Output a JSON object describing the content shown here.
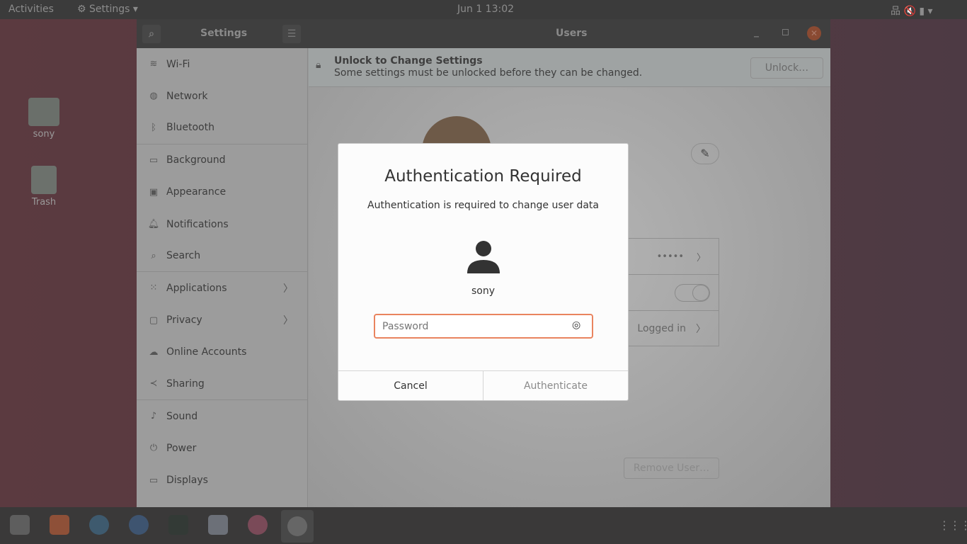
{
  "topbar": {
    "activities": "Activities",
    "app_menu": "Settings",
    "clock": "Jun 1  13:02"
  },
  "desktop": {
    "icons": [
      {
        "label": "sony",
        "icon": "home-folder-icon"
      },
      {
        "label": "Trash",
        "icon": "trash-icon"
      }
    ]
  },
  "window": {
    "sidebar_title": "Settings",
    "title": "Users"
  },
  "sidebar": {
    "items": [
      {
        "label": "Wi-Fi",
        "icon": "wifi-icon"
      },
      {
        "label": "Network",
        "icon": "network-icon"
      },
      {
        "label": "Bluetooth",
        "icon": "bluetooth-icon"
      },
      {
        "label": "Background",
        "icon": "background-icon"
      },
      {
        "label": "Appearance",
        "icon": "appearance-icon"
      },
      {
        "label": "Notifications",
        "icon": "bell-icon"
      },
      {
        "label": "Search",
        "icon": "search-icon"
      },
      {
        "label": "Applications",
        "icon": "grid-icon",
        "chevron": true
      },
      {
        "label": "Privacy",
        "icon": "lock-icon",
        "chevron": true
      },
      {
        "label": "Online Accounts",
        "icon": "cloud-icon"
      },
      {
        "label": "Sharing",
        "icon": "share-icon"
      },
      {
        "label": "Sound",
        "icon": "music-icon"
      },
      {
        "label": "Power",
        "icon": "power-icon"
      },
      {
        "label": "Displays",
        "icon": "display-icon"
      }
    ]
  },
  "banner": {
    "title": "Unlock to Change Settings",
    "subtitle": "Some settings must be unlocked before they can be changed.",
    "unlock": "Unlock…"
  },
  "users": {
    "password_dots": "•••••",
    "last_login": "Logged in",
    "remove": "Remove User…"
  },
  "dialog": {
    "title": "Authentication Required",
    "message": "Authentication is required to change user data",
    "user": "sony",
    "password_placeholder": "Password",
    "cancel": "Cancel",
    "authenticate": "Authenticate"
  },
  "colors": {
    "accent": "#e9845f"
  }
}
